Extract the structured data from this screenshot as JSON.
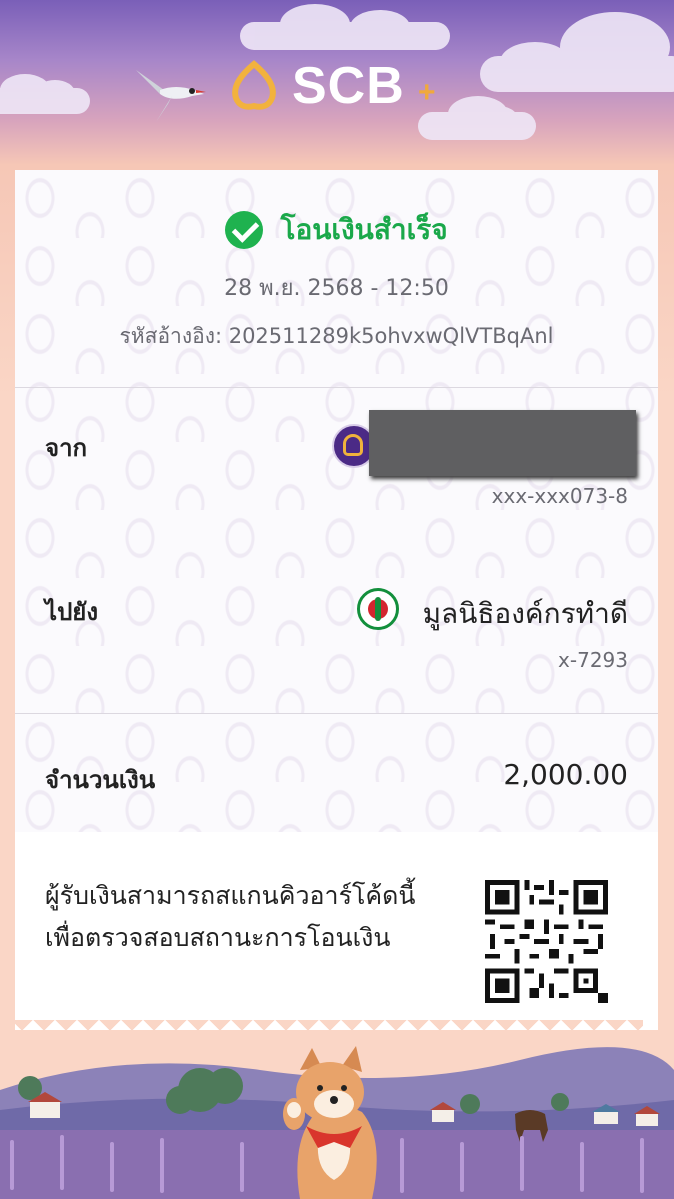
{
  "brand": {
    "name": "SCB",
    "plus": "+"
  },
  "status": {
    "title": "โอนเงินสำเร็จ",
    "icon": "check-circle-icon"
  },
  "datetime": "28 พ.ย. 2568 - 12:50",
  "reference": "รหัสอ้างอิง: 202511289k5ohvxwQlVTBqAnl",
  "from": {
    "label": "จาก",
    "account": "xxx-xxx073-8",
    "bank_icon": "scb-logo-icon"
  },
  "to": {
    "label": "ไปยัง",
    "name": "มูลนิธิองค์กรทำดี",
    "account": "x-7293",
    "bank_icon": "kbank-logo-icon"
  },
  "amount": {
    "label": "จำนวนเงิน",
    "value": "2,000.00"
  },
  "qr_note": {
    "line1": "ผู้รับเงินสามารถสแกนคิวอาร์โค้ดนี้",
    "line2": "เพื่อตรวจสอบสถานะการโอนเงิน"
  },
  "colors": {
    "success": "#1aa84a",
    "brand_purple": "#4b2a86",
    "brand_gold": "#f0b23c"
  }
}
